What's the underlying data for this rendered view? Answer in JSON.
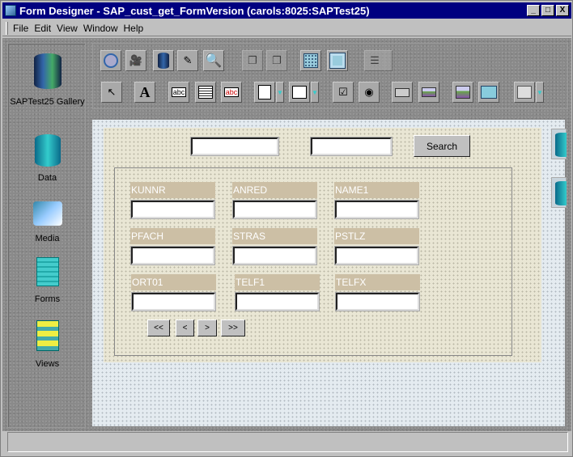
{
  "window": {
    "title": "Form Designer - SAP_cust_get_FormVersion  (carols:8025:SAPTest25)",
    "minimize": "_",
    "maximize": "□",
    "close": "X"
  },
  "menu": [
    "File",
    "Edit",
    "View",
    "Window",
    "Help"
  ],
  "palette": [
    {
      "label": "SAPTest25 Gallery",
      "icon": "gallery-globe-cylinder-icon"
    },
    {
      "label": "Data",
      "icon": "data-cylinder-icon"
    },
    {
      "label": "Media",
      "icon": "media-speaker-icon"
    },
    {
      "label": "Forms",
      "icon": "forms-icon"
    },
    {
      "label": "Views",
      "icon": "views-icon"
    }
  ],
  "toolbar": {
    "row1": [
      "compass-icon",
      "camera-icon",
      "database-icon",
      "edit-pencil-icon",
      "magnifier-icon",
      "bring-front-icon",
      "send-back-icon",
      "grid-icon",
      "snap-grid-icon",
      "tab-order-icon"
    ],
    "row2": [
      "pointer-icon",
      "text-label-icon",
      "text-field-icon",
      "text-area-icon",
      "rich-text-icon",
      "list-box-icon",
      "combo-box-icon",
      "checkbox-icon",
      "radio-icon",
      "button-icon",
      "image-icon",
      "picture-icon",
      "panel-icon",
      "tab-folder-icon"
    ],
    "glyphs": {
      "pointer": "↖",
      "text": "A",
      "field": "abc",
      "rich": "abc",
      "check": "☑",
      "radio": "◉"
    }
  },
  "form": {
    "search_button": "Search",
    "search_input_1": "",
    "search_input_2": "",
    "fields": [
      {
        "label": "KUNNR",
        "value": ""
      },
      {
        "label": "ANRED",
        "value": ""
      },
      {
        "label": "NAME1",
        "value": ""
      },
      {
        "label": "PFACH",
        "value": ""
      },
      {
        "label": "STRAS",
        "value": ""
      },
      {
        "label": "PSTLZ",
        "value": ""
      },
      {
        "label": "ORT01",
        "value": ""
      },
      {
        "label": "TELF1",
        "value": ""
      },
      {
        "label": "TELFX",
        "value": ""
      }
    ],
    "nav": [
      "<<",
      "<",
      ">",
      ">>"
    ]
  }
}
